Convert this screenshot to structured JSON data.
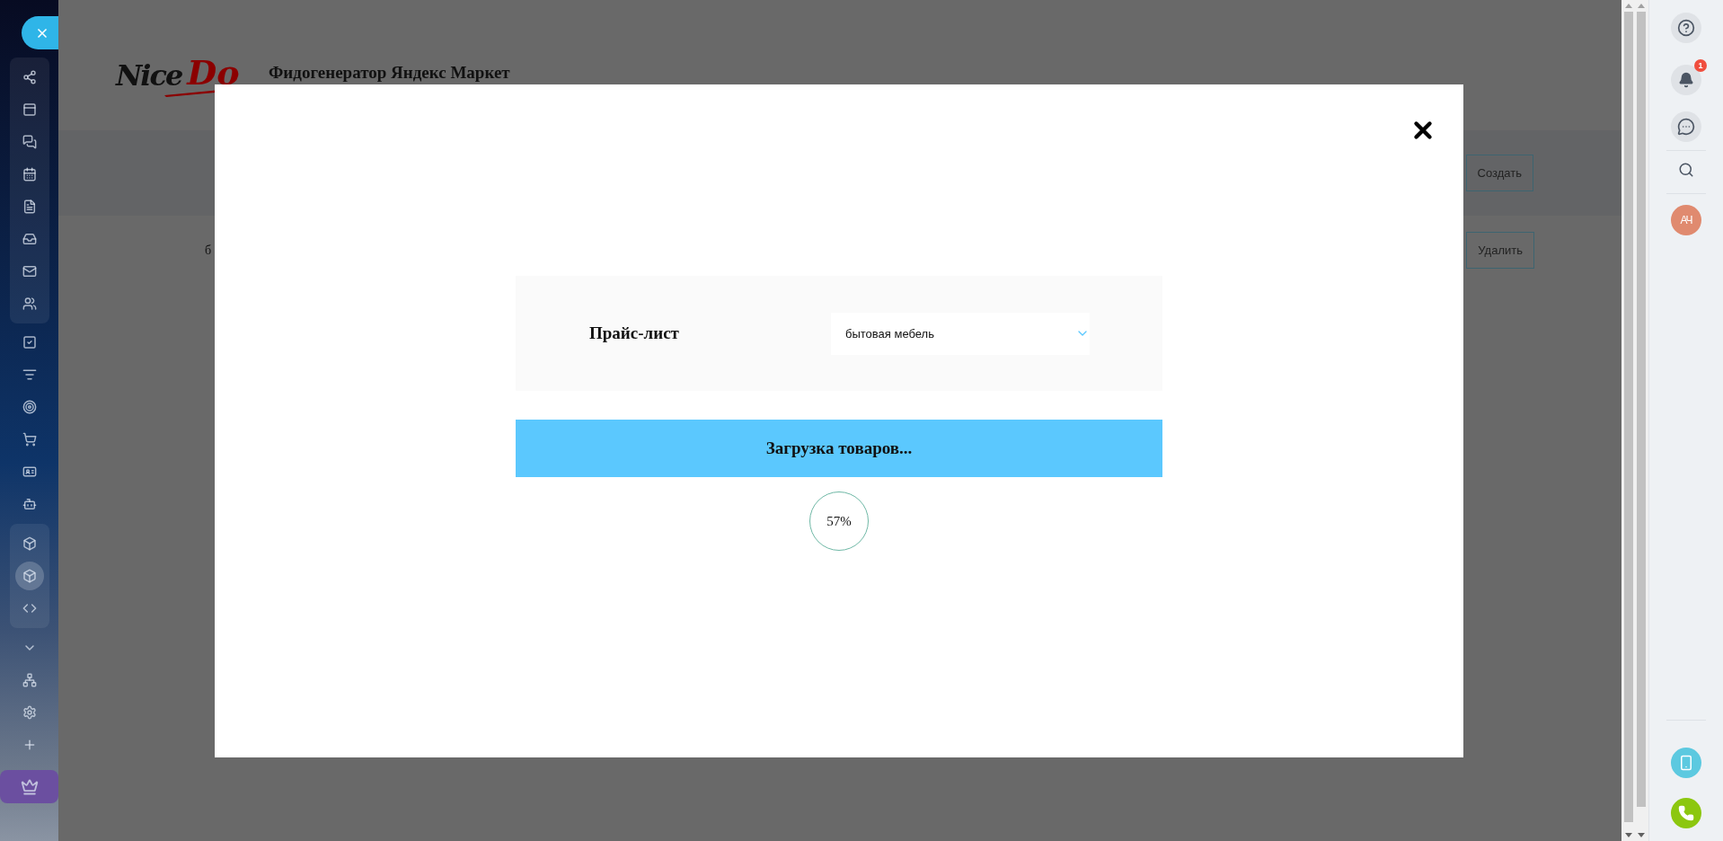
{
  "sidebar": {
    "groups": [
      {
        "kind": "panel",
        "items": [
          {
            "selected": false
          },
          {
            "selected": false
          },
          {
            "selected": false
          },
          {
            "selected": false
          },
          {
            "selected": false
          },
          {
            "selected": false
          },
          {
            "selected": false
          },
          {
            "selected": false
          }
        ]
      },
      {
        "kind": "plain",
        "items": [
          {
            "selected": false
          },
          {
            "selected": false
          },
          {
            "selected": false
          },
          {
            "selected": false
          },
          {
            "selected": false
          },
          {
            "selected": false
          }
        ]
      },
      {
        "kind": "panel",
        "items": [
          {
            "selected": false
          },
          {
            "selected": true
          },
          {
            "selected": false
          }
        ]
      },
      {
        "kind": "plain",
        "items": [
          {
            "selected": false
          },
          {
            "selected": false
          },
          {
            "selected": false
          },
          {
            "selected": false
          }
        ]
      },
      {
        "kind": "highlight",
        "items": [
          {
            "selected": false
          }
        ]
      }
    ]
  },
  "header": {
    "logo": {
      "part_1": "Nice",
      "part_2": "Do"
    },
    "title": "Фидогенератор Яндекс Маркет"
  },
  "toolbar": {
    "button": "Создать"
  },
  "list": {
    "row_text": "б",
    "button": "Удалить"
  },
  "modal": {
    "field": {
      "label": "Прайс-лист",
      "value": "бытовая мебель"
    },
    "status": "Загрузка товаров...",
    "progress": "57%"
  },
  "right_panel": {
    "notifications": "1",
    "avatar": "АЧ"
  }
}
